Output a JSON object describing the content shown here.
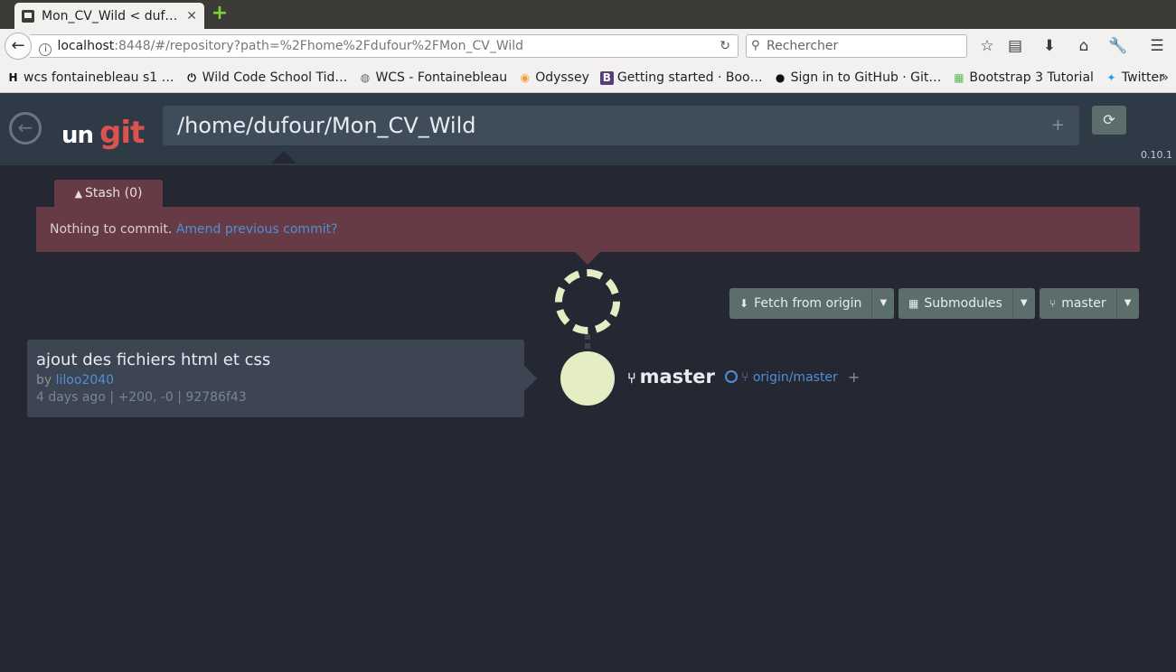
{
  "browser": {
    "tab_title": "Mon_CV_Wild < duf…",
    "url_host": "localhost",
    "url_rest": ":8448/#/repository?path=%2Fhome%2Fdufour%2FMon_CV_Wild",
    "search_placeholder": "Rechercher",
    "bookmarks": [
      {
        "label": "wcs fontainebleau s1 …",
        "icon": "H"
      },
      {
        "label": "Wild Code School Tid…",
        "icon": "⏻"
      },
      {
        "label": "WCS - Fontainebleau",
        "icon": "◍"
      },
      {
        "label": "Odyssey",
        "icon": "◉"
      },
      {
        "label": "Getting started · Boo…",
        "icon": "B"
      },
      {
        "label": "Sign in to GitHub · Git…",
        "icon": "●"
      },
      {
        "label": "Bootstrap 3 Tutorial",
        "icon": "▦"
      },
      {
        "label": "Twitter",
        "icon": "✦"
      }
    ],
    "bookmarks_more": "»"
  },
  "app": {
    "logo_un": "un",
    "logo_git": "git",
    "repo_path": "/home/dufour/Mon_CV_Wild",
    "path_plus": "+",
    "version": "0.10.1",
    "stash_label": "Stash (0)",
    "banner_text": "Nothing to commit. ",
    "banner_link": "Amend previous commit?"
  },
  "toolbar": {
    "fetch_label": "Fetch from origin",
    "submodules_label": "Submodules",
    "branch_label": "master"
  },
  "commit": {
    "message": "ajout des fichiers html et css",
    "by_prefix": "by ",
    "author": "liloo2040",
    "meta": "4 days ago | +200, -0 | 92786f43"
  },
  "graph": {
    "local_branch": "master",
    "remote_branch": "origin/master",
    "add_branch": "+",
    "node_color": "#e4edc4"
  },
  "colors": {
    "accent_link": "#4f90d3",
    "banner_bg": "#673b45",
    "button_bg": "#5b6e6c",
    "logo_red": "#d9534f",
    "page_bg": "#252833"
  }
}
